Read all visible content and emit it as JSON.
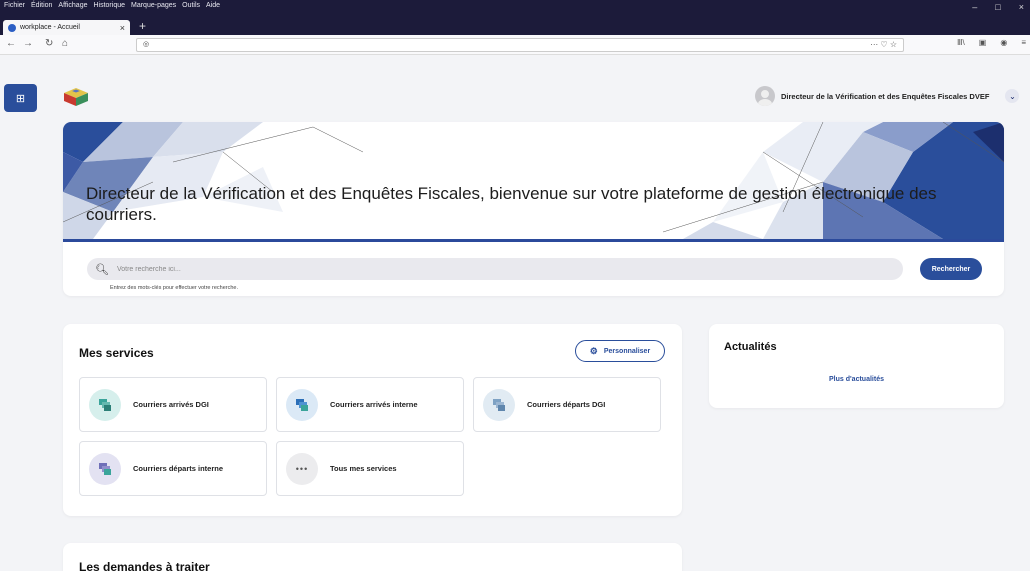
{
  "browser": {
    "menu": [
      "Fichier",
      "Édition",
      "Affichage",
      "Historique",
      "Marque-pages",
      "Outils",
      "Aide"
    ],
    "tab_title": "workplace - Accueil",
    "tab_close": "×",
    "new_tab": "+",
    "url": "",
    "url_actions": "··· ♡ ☆",
    "window_controls": [
      "–",
      "□",
      "×"
    ]
  },
  "header": {
    "user_name": "Directeur de la Vérification et des Enquêtes Fiscales DVEF"
  },
  "hero": {
    "welcome": "Directeur de la Vérification et des Enquêtes Fiscales, bienvenue sur votre plateforme de gestion électronique des courriers."
  },
  "search": {
    "placeholder": "Votre recherche ici...",
    "hint": "Entrez des mots-clés pour effectuer votre recherche.",
    "button": "Rechercher"
  },
  "services": {
    "title": "Mes services",
    "customize": "Personnaliser",
    "items": [
      {
        "label": "Courriers arrivés DGI",
        "icon": "mail-stack-icon",
        "color": "#d6efec"
      },
      {
        "label": "Courriers arrivés interne",
        "icon": "mail-stack-icon",
        "color": "#dbe9f6"
      },
      {
        "label": "Courriers départs DGI",
        "icon": "mail-stack-icon",
        "color": "#e1ebf3"
      },
      {
        "label": "Courriers départs interne",
        "icon": "mail-stack-icon",
        "color": "#e3e2f2"
      },
      {
        "label": "Tous mes services",
        "icon": "more-dots-icon",
        "color": "#ececee"
      }
    ]
  },
  "news": {
    "title": "Actualités",
    "more": "Plus d'actualités"
  },
  "requests": {
    "title": "Les demandes à traiter"
  },
  "colors": {
    "accent": "#2a4e9b",
    "titlebar": "#1c1b3a"
  }
}
